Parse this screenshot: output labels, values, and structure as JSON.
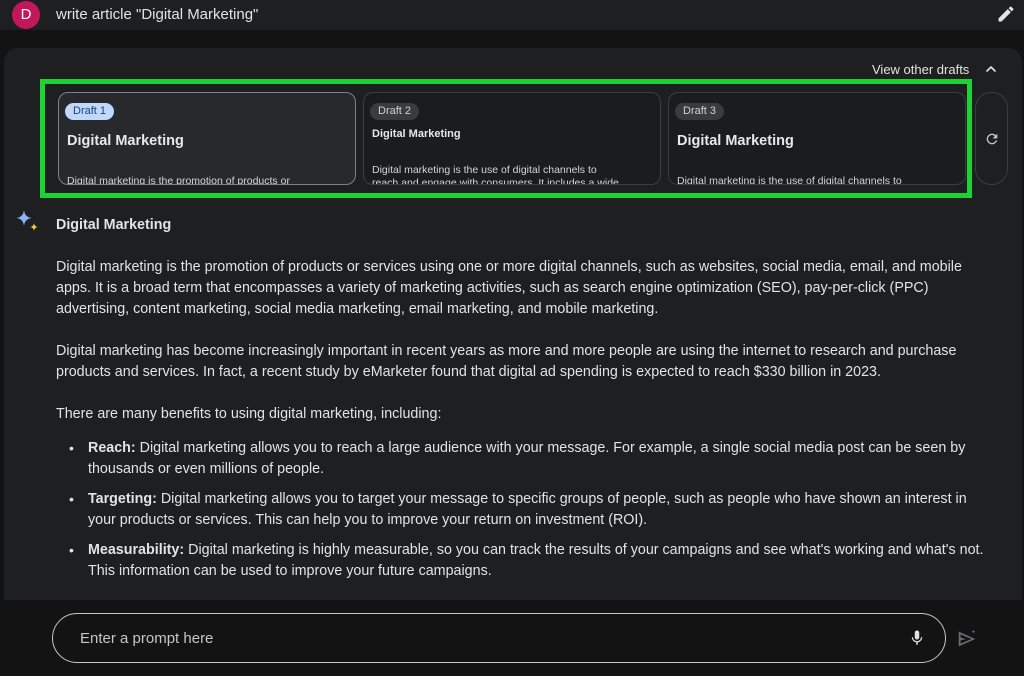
{
  "user": {
    "avatar_letter": "D",
    "prompt": "write article \"Digital Marketing\""
  },
  "drafts_header": {
    "view_other_drafts": "View other drafts"
  },
  "drafts": [
    {
      "badge": "Draft 1",
      "title": "Digital Marketing",
      "preview": "Digital marketing is the promotion of products or"
    },
    {
      "badge": "Draft 2",
      "title": "Digital Marketing",
      "preview": "Digital marketing is the use of digital channels to reach and engage with consumers. It includes a wide"
    },
    {
      "badge": "Draft 3",
      "title": "Digital Marketing",
      "preview": "Digital marketing is the use of digital channels to"
    }
  ],
  "response": {
    "heading": "Digital Marketing",
    "paragraphs": [
      "Digital marketing is the promotion of products or services using one or more digital channels, such as websites, social media, email, and mobile apps. It is a broad term that encompasses a variety of marketing activities, such as search engine optimization (SEO), pay-per-click (PPC) advertising, content marketing, social media marketing, email marketing, and mobile marketing.",
      "Digital marketing has become increasingly important in recent years as more and more people are using the internet to research and purchase products and services. In fact, a recent study by eMarketer found that digital ad spending is expected to reach $330 billion in 2023.",
      "There are many benefits to using digital marketing, including:"
    ],
    "bullets": [
      {
        "term": "Reach:",
        "text": " Digital marketing allows you to reach a large audience with your message. For example, a single social media post can be seen by thousands or even millions of people."
      },
      {
        "term": "Targeting:",
        "text": " Digital marketing allows you to target your message to specific groups of people, such as people who have shown an interest in your products or services. This can help you to improve your return on investment (ROI)."
      },
      {
        "term": "Measurability:",
        "text": " Digital marketing is highly measurable, so you can track the results of your campaigns and see what's working and what's not. This information can be used to improve your future campaigns."
      }
    ]
  },
  "input": {
    "placeholder": "Enter a prompt here"
  },
  "colors": {
    "highlight": "#1ed233",
    "avatar": "#c2185b",
    "draft_badge_selected": "#c2d8fb"
  }
}
